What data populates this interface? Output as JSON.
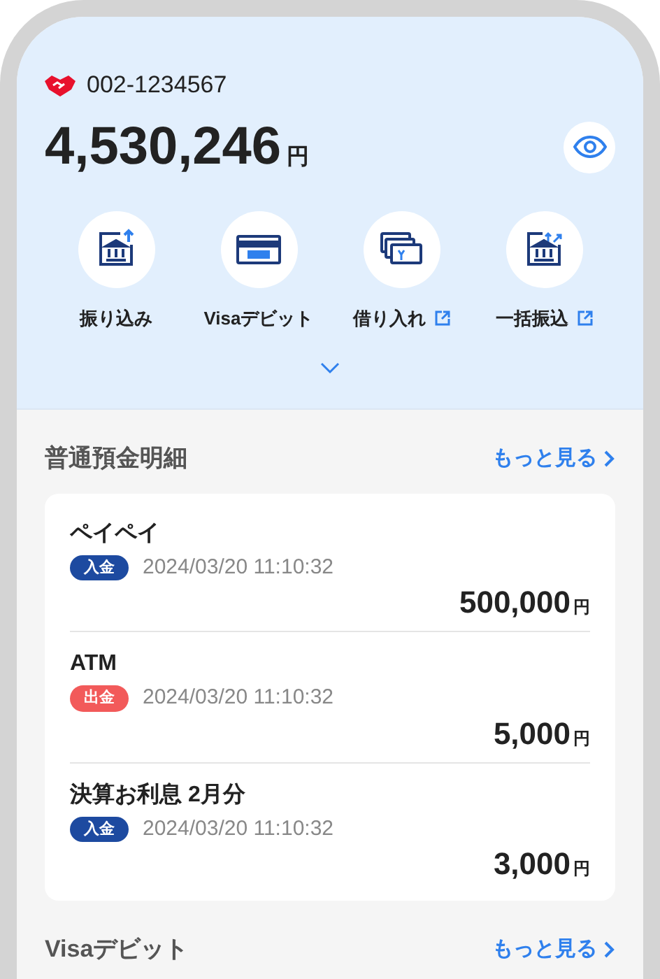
{
  "account": {
    "number": "002-1234567"
  },
  "balance": {
    "amount": "4,530,246",
    "unit": "円"
  },
  "actions": [
    {
      "kind": "transfer",
      "label": "振り込み",
      "external": false
    },
    {
      "kind": "card",
      "label": "Visaデビット",
      "external": false
    },
    {
      "kind": "loan",
      "label": "借り入れ",
      "external": true
    },
    {
      "kind": "bulk",
      "label": "一括振込",
      "external": true
    }
  ],
  "sections": [
    {
      "title": "普通預金明細",
      "more": "もっと見る",
      "transactions": [
        {
          "name": "ペイペイ",
          "kind": "deposit",
          "badge": "入金",
          "datetime": "2024/03/20 11:10:32",
          "amount": "500,000",
          "unit": "円"
        },
        {
          "name": "ATM",
          "kind": "withdrawal",
          "badge": "出金",
          "datetime": "2024/03/20 11:10:32",
          "amount": "5,000",
          "unit": "円"
        },
        {
          "name": "決算お利息 2月分",
          "kind": "deposit",
          "badge": "入金",
          "datetime": "2024/03/20 11:10:32",
          "amount": "3,000",
          "unit": "円"
        }
      ]
    },
    {
      "title": "Visaデビット",
      "more": "もっと見る"
    }
  ]
}
